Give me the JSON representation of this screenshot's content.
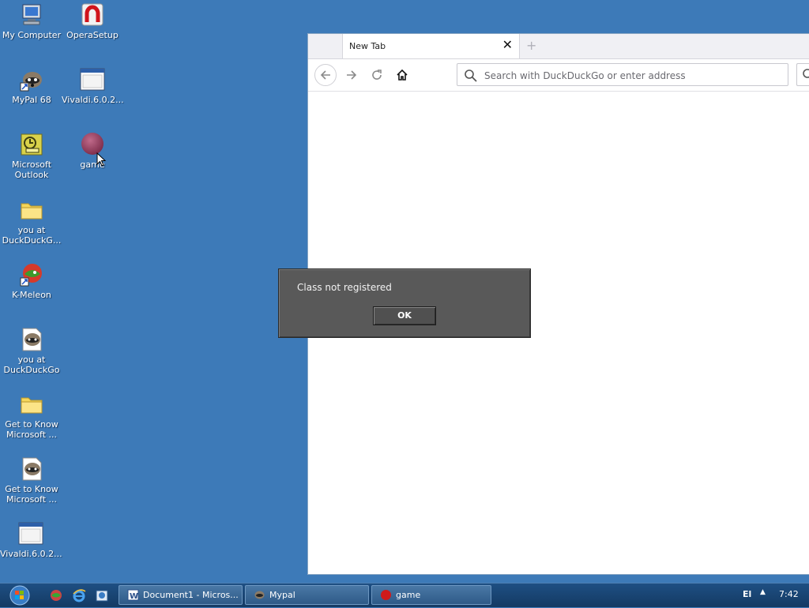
{
  "desktop": {
    "icons": [
      {
        "label": "My Computer",
        "icon": "my-computer-icon"
      },
      {
        "label": "OperaSetup",
        "icon": "opera-icon"
      },
      {
        "label": "MyPal 68",
        "icon": "mypal-raccoon-icon"
      },
      {
        "label": "Vivaldi.6.0.2...",
        "icon": "window-app-icon"
      },
      {
        "label": "Microsoft Outlook",
        "icon": "outlook-icon"
      },
      {
        "label": "game",
        "icon": "red-ball-icon"
      },
      {
        "label": "you at DuckDuckG...",
        "icon": "folder-icon"
      },
      {
        "label": "K-Meleon",
        "icon": "k-meleon-icon"
      },
      {
        "label": "you at DuckDuckGo",
        "icon": "mypal-document-icon"
      },
      {
        "label": "Get to Know Microsoft ...",
        "icon": "folder-icon"
      },
      {
        "label": "Get to Know Microsoft ...",
        "icon": "mypal-document-icon"
      },
      {
        "label": "Vivaldi.6.0.2...",
        "icon": "window-app-icon"
      }
    ]
  },
  "browser": {
    "tab_title": "New Tab",
    "close_glyph": "✕",
    "new_tab_glyph": "+",
    "search_placeholder": "Search with DuckDuckGo or enter address"
  },
  "dialog": {
    "message": "Class not registered",
    "ok_label": "OK",
    "bg_color": "#595959"
  },
  "taskbar": {
    "buttons": [
      {
        "label": "Document1 - Micros...",
        "icon": "word-doc-icon"
      },
      {
        "label": "Mypal",
        "icon": "mypal-raccoon-icon"
      },
      {
        "label": "game",
        "icon": "red-ball-icon"
      }
    ],
    "language": "El",
    "clock": "7:42",
    "color": "#1e4f83"
  }
}
